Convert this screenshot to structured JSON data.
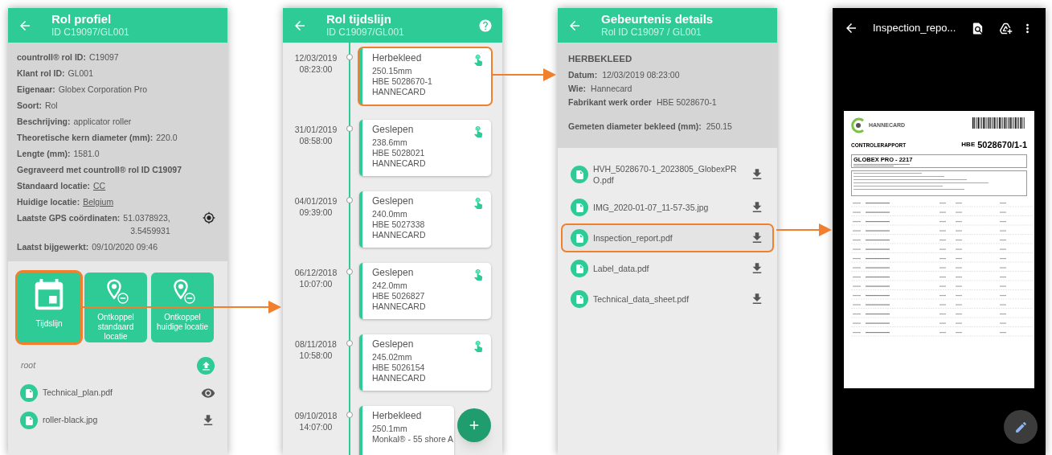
{
  "profile_screen": {
    "title": "Rol profiel",
    "subtitle": "ID C19097/GL001",
    "fields": [
      {
        "kind": "text",
        "label": "countroll® rol ID:",
        "value": "C19097"
      },
      {
        "kind": "text",
        "label": "Klant rol ID:",
        "value": "GL001"
      },
      {
        "kind": "text",
        "label": "Eigenaar:",
        "value": "Globex Corporation Pro"
      },
      {
        "kind": "text",
        "label": "Soort:",
        "value": "Rol"
      },
      {
        "kind": "text",
        "label": "Beschrijving:",
        "value": "applicator roller"
      },
      {
        "kind": "text",
        "label": "Theoretische kern diameter (mm):",
        "value": "220.0"
      },
      {
        "kind": "text",
        "label": "Lengte (mm):",
        "value": "1581.0"
      },
      {
        "kind": "bold",
        "label": "Gegraveerd met countroll® rol ID C19097"
      },
      {
        "kind": "link",
        "label": "Standaard locatie:",
        "value": "CC"
      },
      {
        "kind": "link",
        "label": "Huidige locatie:",
        "value": "Belgium"
      },
      {
        "kind": "gps",
        "label": "Laatste GPS coördinaten:",
        "value": "51.0378923,",
        "value_2": "3.5459931"
      },
      {
        "kind": "text",
        "label": "Laatst bijgewerkt:",
        "value": "09/10/2020 09:46"
      }
    ],
    "tiles": [
      {
        "kind": "calendar",
        "label": "Tijdslijn",
        "highlighted": true
      },
      {
        "kind": "unlink",
        "label": "Ontkoppel standaard locatie",
        "highlighted": false
      },
      {
        "kind": "unlink",
        "label": "Ontkoppel huidige locatie",
        "highlighted": false
      }
    ],
    "folder": "root",
    "files": [
      {
        "name": "Technical_plan.pdf",
        "kind": "view"
      },
      {
        "name": "roller-black.jpg",
        "kind": "download"
      }
    ]
  },
  "timeline_screen": {
    "title": "Rol tijdslijn",
    "subtitle": "ID C19097/GL001",
    "entries": [
      {
        "date": "12/03/2019",
        "time": "08:23:00",
        "type": "Herbekleed",
        "lines": [
          "250.15mm",
          "HBE 5028670-1",
          "HANNECARD"
        ],
        "highlighted": true
      },
      {
        "date": "31/01/2019",
        "time": "08:58:00",
        "type": "Geslepen",
        "lines": [
          "238.6mm",
          "HBE 5028021",
          "HANNECARD"
        ],
        "highlighted": false
      },
      {
        "date": "04/01/2019",
        "time": "09:39:00",
        "type": "Geslepen",
        "lines": [
          "240.0mm",
          "HBE 5027338",
          "HANNECARD"
        ],
        "highlighted": false
      },
      {
        "date": "06/12/2018",
        "time": "10:07:00",
        "type": "Geslepen",
        "lines": [
          "242.0mm",
          "HBE 5026827",
          "HANNECARD"
        ],
        "highlighted": false
      },
      {
        "date": "08/11/2018",
        "time": "10:58:00",
        "type": "Geslepen",
        "lines": [
          "245.02mm",
          "HBE 5026154",
          "HANNECARD"
        ],
        "highlighted": false
      },
      {
        "date": "09/10/2018",
        "time": "14:07:00",
        "type": "Herbekleed",
        "lines": [
          "250.1mm",
          "Monkal® - 55 shore A"
        ],
        "highlighted": false
      }
    ]
  },
  "details_screen": {
    "title": "Gebeurtenis details",
    "subtitle": "Rol ID C19097 / GL001",
    "event_type": "HERBEKLEED",
    "fields": [
      {
        "label": "Datum:",
        "value": "12/03/2019 08:23:00"
      },
      {
        "label": "Wie:",
        "value": "Hannecard"
      },
      {
        "label": "Fabrikant werk order",
        "value": "HBE 5028670-1"
      }
    ],
    "measurement": {
      "label": "Gemeten diameter bekleed (mm):",
      "value": "250.15"
    },
    "files": [
      {
        "name": "HVH_5028670-1_2023805_GlobexPRO.pdf",
        "highlighted": false
      },
      {
        "name": "IMG_2020-01-07_11-57-35.jpg",
        "highlighted": false
      },
      {
        "name": "Inspection_report.pdf",
        "highlighted": true
      },
      {
        "name": "Label_data.pdf",
        "highlighted": false
      },
      {
        "name": "Technical_data_sheet.pdf",
        "highlighted": false
      }
    ]
  },
  "viewer_screen": {
    "title": "Inspection_repo...",
    "document": {
      "logo": "HANNECARD",
      "heading": "CONTROLERAPPORT",
      "number_prefix": "HBE",
      "number": "5028670/1-1",
      "box_title": "GLOBEX PRO - 2217"
    }
  }
}
